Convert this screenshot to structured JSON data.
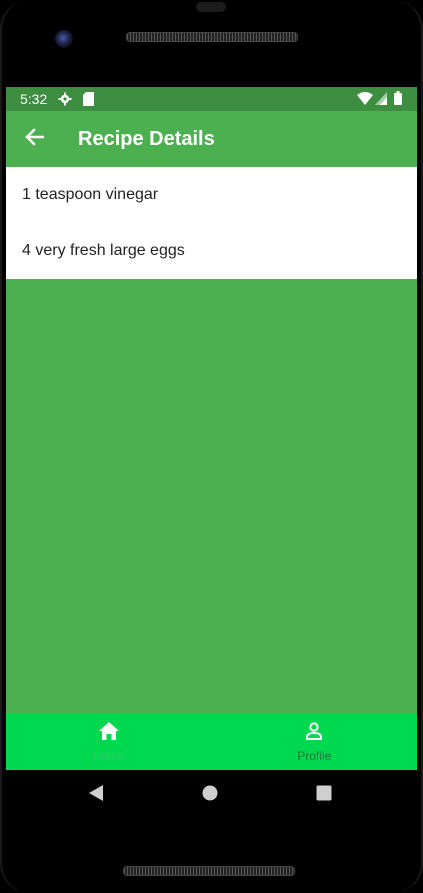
{
  "status_bar": {
    "time": "5:32",
    "icons": [
      "settings-icon",
      "sd-card-icon",
      "wifi-icon",
      "signal-icon",
      "battery-icon"
    ]
  },
  "app_bar": {
    "title": "Recipe Details",
    "back_icon": "arrow-back-icon"
  },
  "ingredients": [
    "1 teaspoon vinegar",
    "4 very fresh large eggs"
  ],
  "bottom_nav": {
    "items": [
      {
        "label": "Home",
        "icon": "home-icon",
        "selected": true
      },
      {
        "label": "Profile",
        "icon": "profile-icon",
        "selected": false
      }
    ]
  },
  "system_nav": {
    "buttons": [
      "back-triangle-icon",
      "home-circle-icon",
      "recents-square-icon"
    ]
  },
  "colors": {
    "primary": "#4caf50",
    "status_bar": "#3e8e41",
    "bottom_nav_bg": "#00d84f",
    "list_bg": "#ffffff"
  }
}
